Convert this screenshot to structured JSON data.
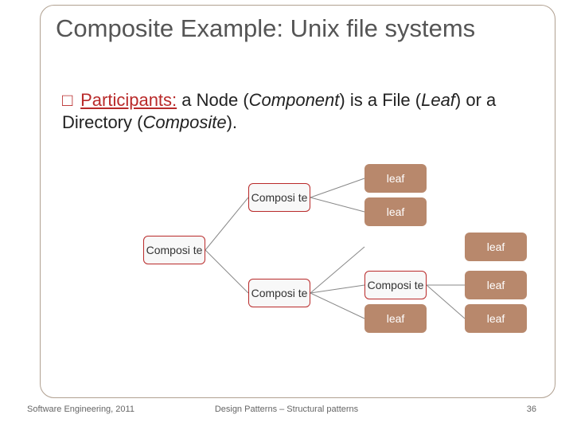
{
  "title": "Composite Example: Unix file systems",
  "body": {
    "bullet": "□",
    "lead": "Participants:",
    "rest1": " a Node (",
    "comp": "Component",
    "rest2": ") is a File (",
    "leaf": "Leaf",
    "rest3": ") or a Directory (",
    "composite": "Composite",
    "rest4": ")."
  },
  "boxes": {
    "composite": "Composi\nte",
    "leaf": "leaf"
  },
  "footer": {
    "left": "Software Engineering, 2011",
    "center": "Design Patterns – Structural patterns",
    "right": "36"
  }
}
